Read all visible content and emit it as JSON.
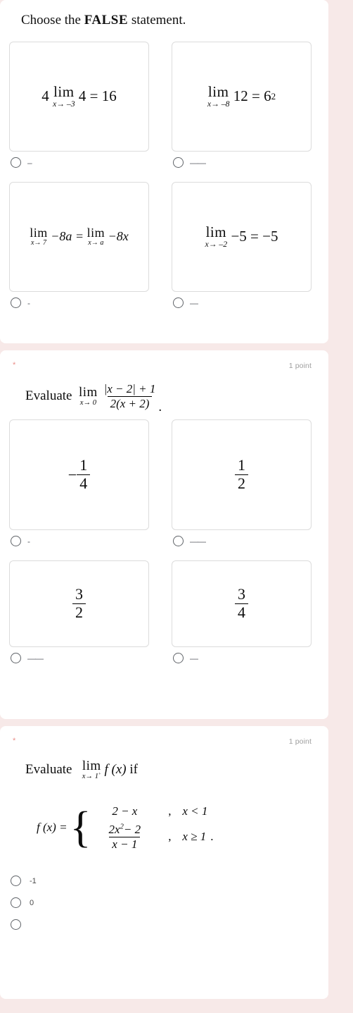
{
  "theme": {
    "page_background": "#f7e9e8",
    "card_background": "#ffffff",
    "required_star_color": "#d93025",
    "muted_text_color": "#9e9e9e"
  },
  "questions": [
    {
      "id": "q-false-statement",
      "title_prefix": "Choose the ",
      "title_bold": "FALSE",
      "title_suffix": " statement.",
      "options": [
        {
          "id": "opt-4lim4-16",
          "radio_label": "–",
          "math": {
            "lead": "4",
            "lim_sub": "x→ –3",
            "body": "4 = 16"
          }
        },
        {
          "id": "opt-lim12-6sq",
          "radio_label": "——",
          "math": {
            "lead": "",
            "lim_sub": "x→ –8",
            "body": "12 = 6",
            "exponent": "2"
          }
        },
        {
          "id": "opt-lim-8a-lim-8x",
          "radio_label": "-",
          "math": {
            "lim_sub_left": "x→ 7",
            "mid": "−8a =",
            "lim_sub_right": "x→ a",
            "tail": "−8x"
          }
        },
        {
          "id": "opt-lim-5-eq-5",
          "radio_label": "—",
          "math": {
            "lim_sub": "x→ –2",
            "body": "−5 = −5"
          }
        }
      ]
    },
    {
      "id": "q-evaluate-abs-limit",
      "required_mark": "*",
      "point_label": "1 point",
      "stem_text": "Evaluate",
      "stem_lim_sub": "x→ 0",
      "stem_numerator": "|x − 2| + 1",
      "stem_denominator": "2(x + 2)",
      "stem_period": ".",
      "options": [
        {
          "id": "opt-neg-one-fourth",
          "radio_label": "-",
          "sign": "−",
          "num": "1",
          "den": "4"
        },
        {
          "id": "opt-one-half",
          "radio_label": "——",
          "sign": "",
          "num": "1",
          "den": "2"
        },
        {
          "id": "opt-three-halves",
          "radio_label": "——",
          "sign": "",
          "num": "3",
          "den": "2"
        },
        {
          "id": "opt-three-fourths",
          "radio_label": "—",
          "sign": "",
          "num": "3",
          "den": "4"
        }
      ]
    },
    {
      "id": "q-evaluate-piecewise-limit",
      "required_mark": "*",
      "point_label": "1 point",
      "stem_text": "Evaluate",
      "stem_lim_sub": "x→ 1",
      "stem_lim_sub_sup": "+",
      "stem_function": "f (x)",
      "stem_if": "if",
      "piecewise": {
        "lhs": "f (x) =",
        "case1_expr": "2 − x",
        "case1_comma": ",",
        "case1_cond": "x < 1",
        "case2_num": "2x",
        "case2_num_sup": "2",
        "case2_num_tail": "− 2",
        "case2_den": "x − 1",
        "case2_comma": ",",
        "case2_cond": "x ≥ 1",
        "trailing_dot": "."
      },
      "options": [
        {
          "id": "opt-neg-1",
          "radio_label": "-1"
        },
        {
          "id": "opt-0",
          "radio_label": "0"
        },
        {
          "id": "opt-partial-cut",
          "radio_label": ""
        }
      ]
    }
  ]
}
